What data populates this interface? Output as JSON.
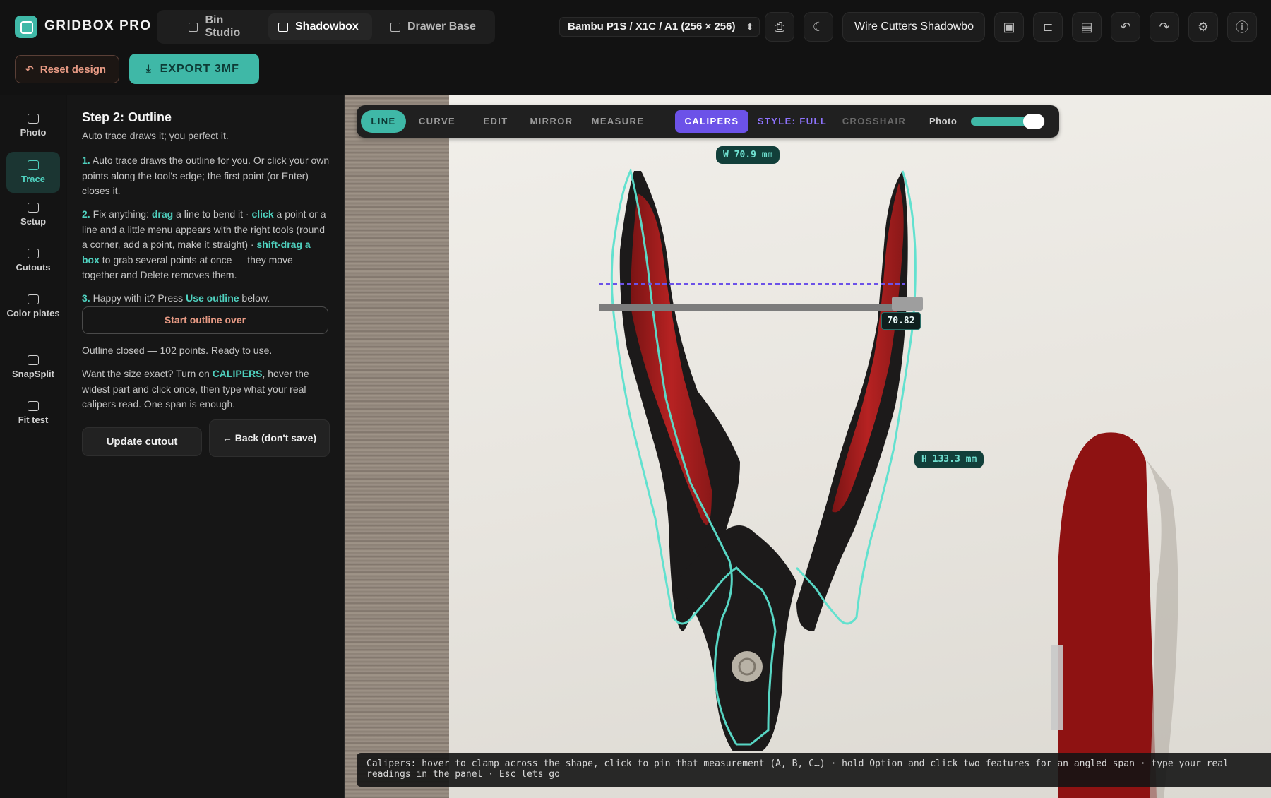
{
  "app": {
    "brand": "GRIDBOX PRO",
    "accent": "#3fb8a7",
    "caliper_color": "#6c52e8"
  },
  "modes": [
    {
      "label": "Bin Studio",
      "icon": "bin-icon",
      "active": false
    },
    {
      "label": "Shadowbox",
      "icon": "shadowbox-icon",
      "active": true
    },
    {
      "label": "Drawer Base",
      "icon": "drawer-icon",
      "active": false
    }
  ],
  "header": {
    "printer": "Bambu P1S / X1C / A1 (256 × 256)",
    "project_name": "Wire Cutters Shadowbo",
    "icons": [
      "print-icon",
      "moon-icon",
      "save-icon",
      "folder-icon",
      "layers-icon",
      "undo-icon",
      "redo-icon",
      "settings-icon",
      "info-icon"
    ]
  },
  "actions": {
    "reset": "Reset design",
    "export": "EXPORT 3MF"
  },
  "rail": [
    {
      "label": "Photo",
      "icon": "photo-icon",
      "active": false
    },
    {
      "label": "Trace",
      "icon": "trace-icon",
      "active": true
    },
    {
      "label": "Setup",
      "icon": "setup-icon",
      "active": false
    },
    {
      "label": "Cutouts",
      "icon": "cutouts-icon",
      "active": false
    },
    {
      "label": "Color plates",
      "icon": "layers-icon",
      "active": false
    },
    {
      "label": "SnapSplit",
      "icon": "split-icon",
      "active": false
    },
    {
      "label": "Fit test",
      "icon": "check-icon",
      "active": false
    }
  ],
  "panel": {
    "title": "Step 2: Outline",
    "subtitle": "Auto trace draws it; you perfect it.",
    "step1": {
      "num": "1.",
      "text": " Auto trace draws the outline for you. Or click your own points along the tool's edge; the first point (or Enter) closes it."
    },
    "step2": {
      "num": "2.",
      "t1": " Fix anything: ",
      "k1": "drag",
      "t2": " a line to bend it · ",
      "k2": "click",
      "t3": " a point or a line and a little menu appears with the right tools (round a corner, add a point, make it straight) · ",
      "k3": "shift-drag a box",
      "t4": " to grab several points at once — they move together and Delete removes them."
    },
    "step3": {
      "num": "3.",
      "t1": " Happy with it? Press ",
      "k1": "Use outline",
      "t2": " below."
    },
    "start_over": "Start outline over",
    "status": "Outline closed — 102 points. Ready to use.",
    "hint": {
      "t1": "Want the size exact? Turn on ",
      "k1": "CALIPERS",
      "t2": ", hover the widest part and click once, then type what your real calipers read. One span is enough."
    },
    "update": "Update cutout",
    "back": "← Back (don't save)"
  },
  "toolbar": {
    "tools": [
      "LINE",
      "CURVE",
      "EDIT",
      "MIRROR",
      "MEASURE",
      "CALIPERS",
      "STYLE: FULL",
      "CROSSHAIR"
    ],
    "active_tool": "LINE",
    "active_mode": "CALIPERS",
    "photo_label": "Photo",
    "photo_opacity": 0.85
  },
  "measure": {
    "width": "W 70.9 mm",
    "height": "H 133.3 mm",
    "caliper_reading": "70.82"
  },
  "canvas_hint": "Calipers: hover to clamp across the shape, click to pin that measurement (A, B, C…) · hold Option and click two features for an angled span · type your real readings in the panel · Esc lets go"
}
